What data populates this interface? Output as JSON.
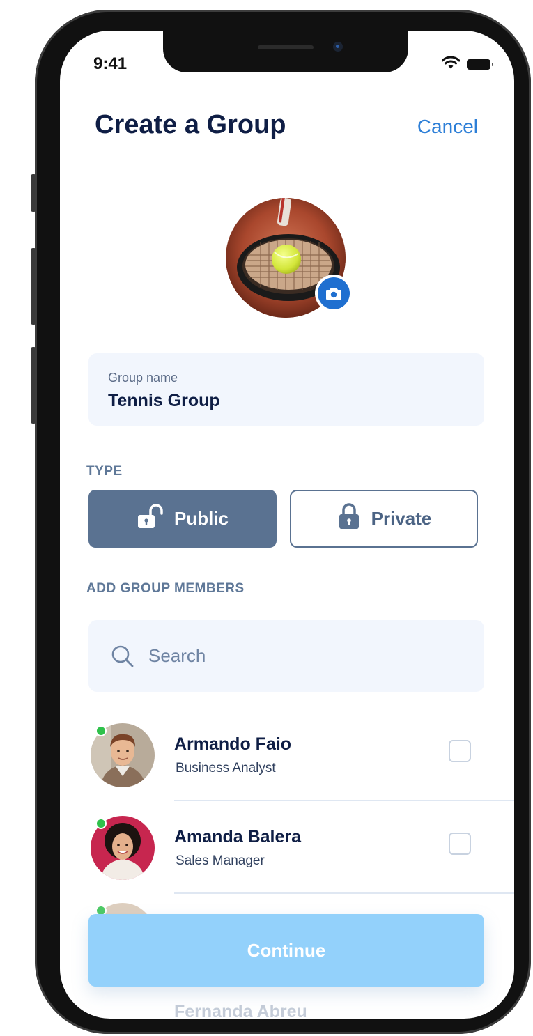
{
  "status_bar": {
    "time": "9:41"
  },
  "header": {
    "title": "Create a Group",
    "cancel_label": "Cancel"
  },
  "group_photo": {
    "subject": "tennis racket and ball"
  },
  "group_name": {
    "label": "Group name",
    "value": "Tennis Group"
  },
  "type": {
    "section_label": "TYPE",
    "options": [
      {
        "label": "Public",
        "icon": "unlocked-lock-icon",
        "selected": true
      },
      {
        "label": "Private",
        "icon": "lock-icon",
        "selected": false
      }
    ]
  },
  "members": {
    "section_label": "ADD GROUP MEMBERS",
    "search_placeholder": "Search",
    "list": [
      {
        "name": "Armando Faio",
        "role": "Business Analyst",
        "online": true,
        "checked": false
      },
      {
        "name": "Amanda Balera",
        "role": "Sales Manager",
        "online": true,
        "checked": false
      }
    ],
    "faded_name": "Fernanda Abreu"
  },
  "footer": {
    "continue_label": "Continue"
  },
  "colors": {
    "accent_blue": "#2d7fd7",
    "navy": "#0f1e45",
    "public_selected": "#5a7291",
    "continue_disabled": "#93d1fb",
    "online_green": "#2fc14b"
  }
}
